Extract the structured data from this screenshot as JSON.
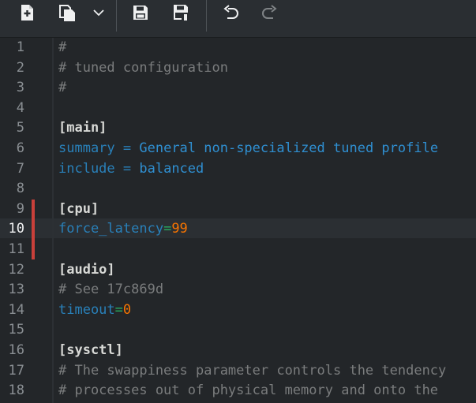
{
  "toolbar": {
    "buttons": [
      {
        "name": "new-document",
        "icon": "new-document-icon"
      },
      {
        "name": "open-document",
        "icon": "documents-icon"
      },
      {
        "name": "open-menu",
        "icon": "chevron-down-icon"
      },
      {
        "name": "save",
        "icon": "save-icon"
      },
      {
        "name": "save-as",
        "icon": "save-as-icon"
      },
      {
        "name": "undo",
        "icon": "undo-icon"
      },
      {
        "name": "redo",
        "icon": "redo-icon"
      }
    ]
  },
  "colors": {
    "background": "#232629",
    "toolbar": "#2a2e32",
    "comment": "#7a7c7d",
    "section": "#d8d9d6",
    "key": "#2980b9",
    "value": "#2f8fd1",
    "number": "#f67400",
    "modified_marker": "#c9403a"
  },
  "editor": {
    "current_line": 10,
    "lines": [
      {
        "n": "1",
        "comment": "#"
      },
      {
        "n": "2",
        "comment": "# tuned configuration"
      },
      {
        "n": "3",
        "comment": "#"
      },
      {
        "n": "4"
      },
      {
        "n": "5",
        "section": "[main]"
      },
      {
        "n": "6",
        "key": "summary",
        "op": " = ",
        "val": "General non-specialized tuned profile"
      },
      {
        "n": "7",
        "key": "include",
        "op": " = ",
        "val": "balanced"
      },
      {
        "n": "8"
      },
      {
        "n": "9",
        "section": "[cpu]"
      },
      {
        "n": "10",
        "key": "force_latency",
        "op": "=",
        "num": "99"
      },
      {
        "n": "11"
      },
      {
        "n": "12",
        "section": "[audio]"
      },
      {
        "n": "13",
        "comment": "# See 17c869d"
      },
      {
        "n": "14",
        "key": "timeout",
        "op": "=",
        "num": "0"
      },
      {
        "n": "15"
      },
      {
        "n": "16",
        "section": "[sysctl]"
      },
      {
        "n": "17",
        "comment": "# The swappiness parameter controls the tendency"
      },
      {
        "n": "18",
        "comment": "# processes out of physical memory and onto the"
      }
    ]
  }
}
